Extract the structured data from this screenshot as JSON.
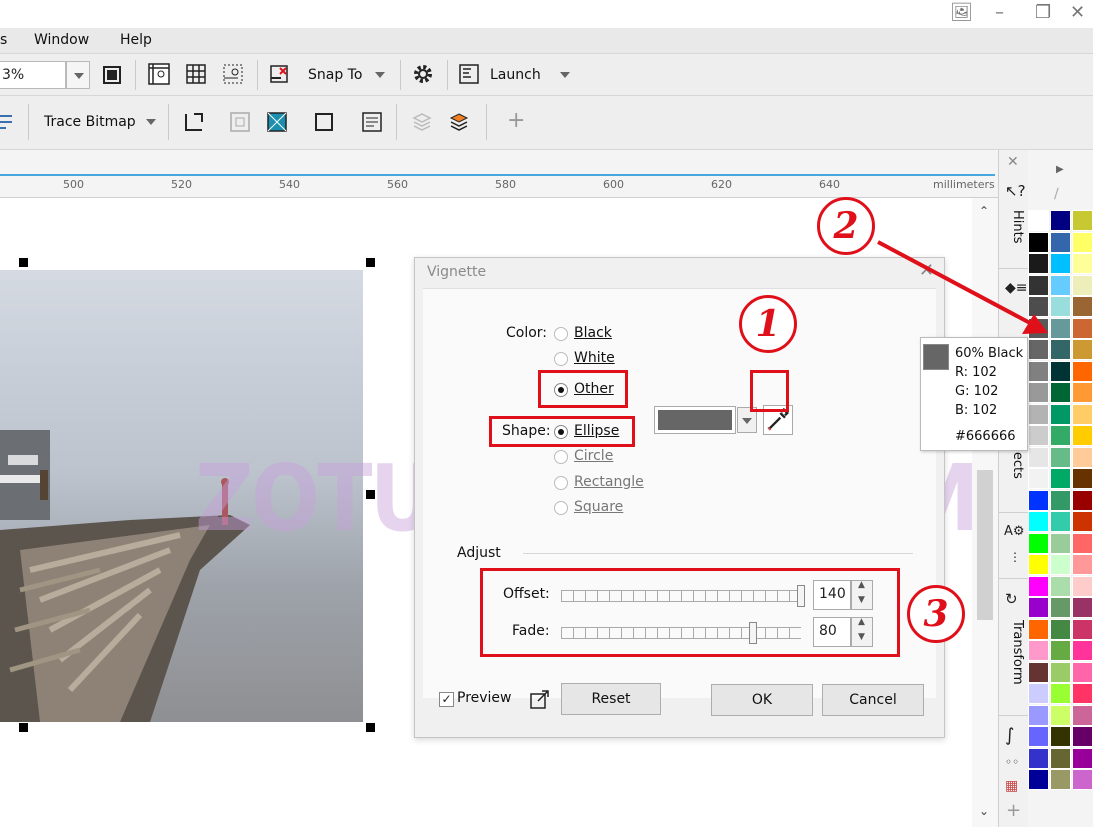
{
  "menu": {
    "partial": "s",
    "window": "Window",
    "help": "Help"
  },
  "toolbar1": {
    "zoom_value": "3%",
    "snap_to": "Snap To",
    "launch": "Launch"
  },
  "toolbar2": {
    "trace_bitmap": "Trace Bitmap"
  },
  "ruler": {
    "ticks": [
      "500",
      "520",
      "540",
      "560",
      "580",
      "600",
      "620",
      "640"
    ],
    "unit": "millimeters"
  },
  "dialog": {
    "title": "Vignette",
    "color_label": "Color:",
    "color_black": "Black",
    "color_white": "White",
    "color_other": "Other",
    "selected_color_hex": "#666666",
    "shape_label": "Shape:",
    "shape_ellipse": "Ellipse",
    "shape_circle": "Circle",
    "shape_rectangle": "Rectangle",
    "shape_square": "Square",
    "adjust_label": "Adjust",
    "offset_label": "Offset:",
    "offset_value": "140",
    "fade_label": "Fade:",
    "fade_value": "80",
    "preview_label": "Preview",
    "preview_checked": true,
    "reset_label": "Reset",
    "ok_label": "OK",
    "cancel_label": "Cancel"
  },
  "tooltip": {
    "name": "60% Black",
    "r": "R: 102",
    "g": "G: 102",
    "b": "B: 102",
    "hex": "#666666"
  },
  "docker": {
    "hints": "Hints",
    "objects": "bjects",
    "transform": "Transform"
  },
  "annotations": {
    "n1": "1",
    "n2": "2",
    "n3": "3"
  },
  "watermark": "ZOTUTORIAL.COM",
  "palette_colors": [
    [
      "#ffffff",
      "#000080",
      "#c8c832"
    ],
    [
      "#000000",
      "#3366aa",
      "#ffff66"
    ],
    [
      "#1a1a1a",
      "#00bfff",
      "#ffff99"
    ],
    [
      "#333333",
      "#66ccff",
      "#eeeebb"
    ],
    [
      "#4d4d4d",
      "#99dddd",
      "#996633"
    ],
    [
      "#595959",
      "#669999",
      "#cc6633"
    ],
    [
      "#666666",
      "#336666",
      "#cc9933"
    ],
    [
      "#808080",
      "#003333",
      "#ff6600"
    ],
    [
      "#999999",
      "#006633",
      "#ff9933"
    ],
    [
      "#b3b3b3",
      "#009966",
      "#ffcc66"
    ],
    [
      "#cccccc",
      "#33aa66",
      "#ffcc00"
    ],
    [
      "#e6e6e6",
      "#66bb88",
      "#ffcc99"
    ],
    [
      "#f2f2f2",
      "#00aa66",
      "#663300"
    ],
    [
      "#0033ff",
      "#339966",
      "#990000"
    ],
    [
      "#00ffff",
      "#33ccaa",
      "#cc3300"
    ],
    [
      "#00ff00",
      "#99cc99",
      "#ff6666"
    ],
    [
      "#ffff00",
      "#ccffcc",
      "#ff9999"
    ],
    [
      "#ff00ff",
      "#aaddaa",
      "#ffcccc"
    ],
    [
      "#9900cc",
      "#669966",
      "#993366"
    ],
    [
      "#ff6600",
      "#448844",
      "#cc3366"
    ],
    [
      "#ff99cc",
      "#66aa44",
      "#ff3399"
    ],
    [
      "#663333",
      "#99cc66",
      "#ff66aa"
    ],
    [
      "#ccccff",
      "#99ff33",
      "#ff3366"
    ],
    [
      "#9999ff",
      "#ccff66",
      "#cc6699"
    ],
    [
      "#6666ff",
      "#333300",
      "#660066"
    ],
    [
      "#3333cc",
      "#666633",
      "#990099"
    ],
    [
      "#000099",
      "#999966",
      "#cc66cc"
    ]
  ]
}
